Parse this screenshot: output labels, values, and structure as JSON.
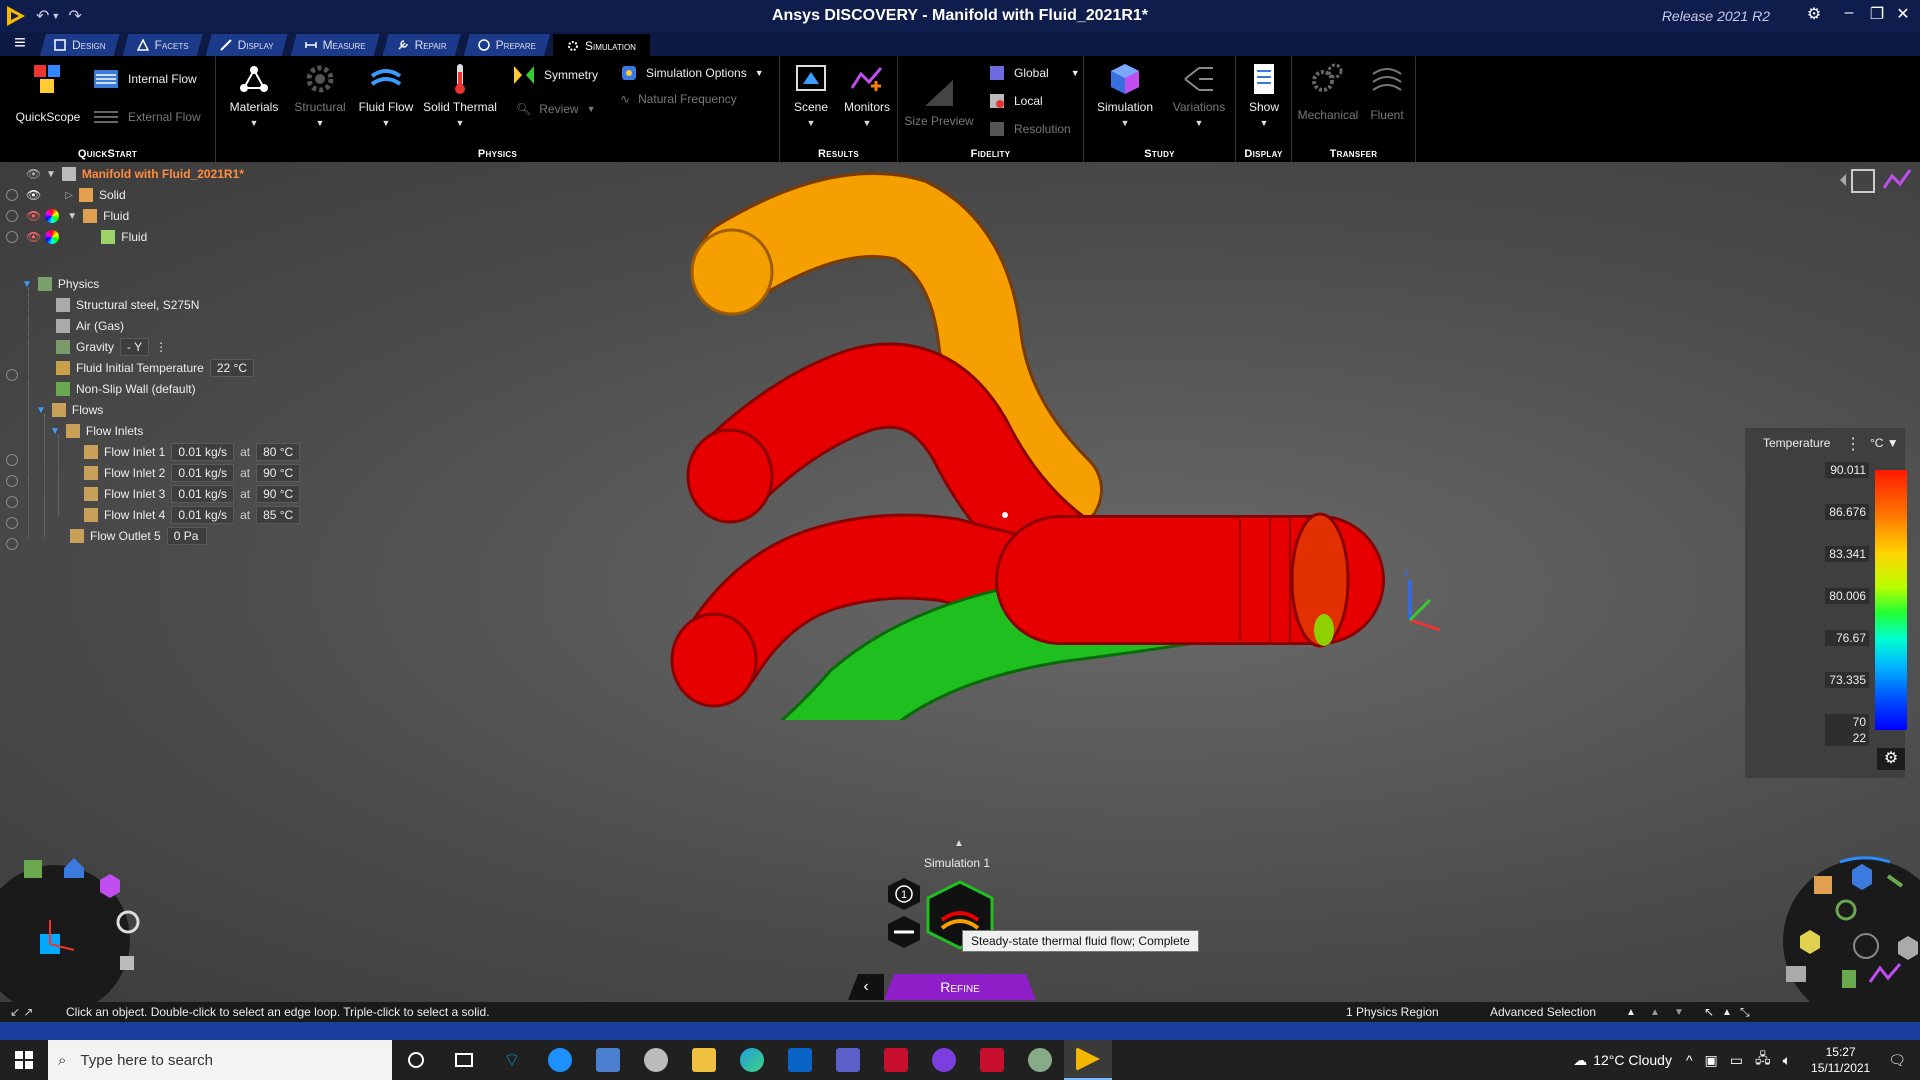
{
  "window": {
    "title": "Ansys DISCOVERY - Manifold with Fluid_2021R1*",
    "release": "Release 2021 R2"
  },
  "tabs": [
    {
      "label": "Design",
      "icon": "design-icon"
    },
    {
      "label": "Facets",
      "icon": "facets-icon"
    },
    {
      "label": "Display",
      "icon": "display-icon"
    },
    {
      "label": "Measure",
      "icon": "measure-icon"
    },
    {
      "label": "Repair",
      "icon": "repair-icon"
    },
    {
      "label": "Prepare",
      "icon": "prepare-icon"
    },
    {
      "label": "Simulation",
      "icon": "simulation-icon",
      "active": true
    }
  ],
  "ribbon": {
    "quickstart": {
      "label": "QuickStart",
      "quickscope": "QuickScope",
      "internal_flow": "Internal Flow",
      "external_flow": "External Flow"
    },
    "physics": {
      "label": "Physics",
      "materials": "Materials",
      "structural": "Structural",
      "fluid_flow": "Fluid Flow",
      "solid_thermal": "Solid Thermal",
      "symmetry": "Symmetry",
      "review": "Review",
      "simulation_options": "Simulation Options",
      "natural_frequency": "Natural Frequency"
    },
    "results": {
      "label": "Results",
      "scene": "Scene",
      "monitors": "Monitors"
    },
    "fidelity": {
      "label": "Fidelity",
      "size_preview": "Size Preview",
      "global": "Global",
      "local": "Local",
      "resolution": "Resolution"
    },
    "study": {
      "label": "Study",
      "simulation": "Simulation",
      "variations": "Variations"
    },
    "display": {
      "label": "Display",
      "show": "Show"
    },
    "transfer": {
      "label": "Transfer",
      "mechanical": "Mechanical",
      "fluent": "Fluent"
    }
  },
  "tree": {
    "root": "Manifold with Fluid_2021R1*",
    "solid": "Solid",
    "fluid_group": "Fluid",
    "fluid_body": "Fluid",
    "physics": "Physics",
    "material_1": "Structural steel, S275N",
    "material_2": "Air (Gas)",
    "gravity": {
      "label": "Gravity",
      "value": "- Y"
    },
    "fluid_temp": {
      "label": "Fluid Initial Temperature",
      "value": "22 °C"
    },
    "wall": "Non-Slip Wall (default)",
    "flows": "Flows",
    "flow_inlets": "Flow Inlets",
    "at": "at",
    "inlets": [
      {
        "label": "Flow Inlet 1",
        "rate": "0.01 kg/s",
        "temp": "80 °C"
      },
      {
        "label": "Flow Inlet 2",
        "rate": "0.01 kg/s",
        "temp": "90 °C"
      },
      {
        "label": "Flow Inlet 3",
        "rate": "0.01 kg/s",
        "temp": "90 °C"
      },
      {
        "label": "Flow Inlet 4",
        "rate": "0.01 kg/s",
        "temp": "85 °C"
      }
    ],
    "outlet": {
      "label": "Flow Outlet 5",
      "value": "0 Pa"
    }
  },
  "legend": {
    "title": "Temperature",
    "unit": "°C",
    "ticks": [
      "90.011",
      "86.676",
      "83.341",
      "80.006",
      "76.67",
      "73.335",
      "70",
      "22"
    ]
  },
  "simulation": {
    "label": "Simulation 1",
    "count": "1",
    "tooltip": "Steady-state thermal fluid flow; Complete",
    "refine": "Refine"
  },
  "status": {
    "message": "Click an object. Double-click to select an edge loop. Triple-click to select a solid.",
    "region": "1 Physics Region",
    "selection": "Advanced Selection"
  },
  "taskbar": {
    "search_placeholder": "Type here to search",
    "weather": "12°C  Cloudy",
    "time": "15:27",
    "date": "15/11/2021"
  },
  "colors": {
    "pipe_hot": "#e60000",
    "pipe_warm": "#f5a000",
    "pipe_cool": "#1fbf1f",
    "refine": "#8e1ec7"
  }
}
